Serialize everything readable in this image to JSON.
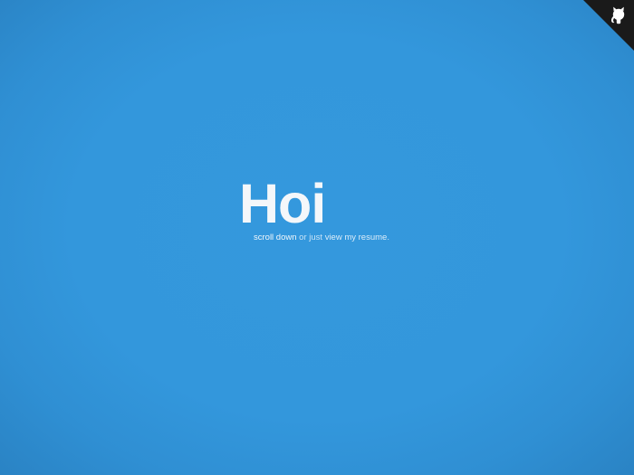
{
  "hero": {
    "title": "Hoi",
    "scroll_link": "scroll down",
    "connector": "or just",
    "resume_link": "view my resume",
    "period": "."
  },
  "corner_badge": {
    "icon": "octocat-icon"
  },
  "colors": {
    "background": "#3296DC",
    "title": "#F4F7FA",
    "badge": "#1A1A1A"
  }
}
